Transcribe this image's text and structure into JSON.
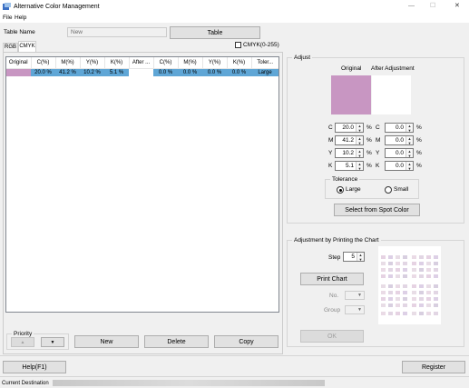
{
  "window": {
    "title": "Alternative Color Management",
    "min": "—",
    "max": "☐",
    "close": "✕"
  },
  "menu": {
    "file": "File",
    "help": "Help"
  },
  "top": {
    "table_name_label": "Table Name",
    "table_name_value": "New",
    "table_button": "Table"
  },
  "tabs": [
    {
      "label": "RGB"
    },
    {
      "label": "CMYK"
    }
  ],
  "cmyk_range_label": "CMYK(0-255)",
  "table": {
    "headers": [
      "Original",
      "C(%)",
      "M(%)",
      "Y(%)",
      "K(%)",
      "After ...",
      "C(%)",
      "M(%)",
      "Y(%)",
      "K(%)",
      "Toler..."
    ],
    "rows": [
      {
        "original_color": "#c896c2",
        "c": "20.0 %",
        "m": "41.2 %",
        "y": "10.2 %",
        "k": "5.1 %",
        "after_color": "#ffffff",
        "c2": "0.0 %",
        "m2": "0.0 %",
        "y2": "0.0 %",
        "k2": "0.0 %",
        "tolerance": "Large"
      }
    ]
  },
  "priority": {
    "label": "Priority",
    "up": "▲",
    "down": "▼"
  },
  "actions": {
    "new": "New",
    "delete": "Delete",
    "copy": "Copy"
  },
  "adjust": {
    "label": "Adjust",
    "original_label": "Original",
    "after_label": "After Adjustment",
    "original_color": "#c896c2",
    "after_color": "#ffffff",
    "left": [
      {
        "ch": "C",
        "value": "20.0",
        "unit": "%"
      },
      {
        "ch": "M",
        "value": "41.2",
        "unit": "%"
      },
      {
        "ch": "Y",
        "value": "10.2",
        "unit": "%"
      },
      {
        "ch": "K",
        "value": "5.1",
        "unit": "%"
      }
    ],
    "right": [
      {
        "ch": "C",
        "value": "0.0",
        "unit": "%"
      },
      {
        "ch": "M",
        "value": "0.0",
        "unit": "%"
      },
      {
        "ch": "Y",
        "value": "0.0",
        "unit": "%"
      },
      {
        "ch": "K",
        "value": "0.0",
        "unit": "%"
      }
    ],
    "tolerance": {
      "label": "Tolerance",
      "large": "Large",
      "small": "Small",
      "selected": "large"
    },
    "spot_button": "Select from Spot Color"
  },
  "printing": {
    "label": "Adjustment by Printing the Chart",
    "step_label": "Step",
    "step_value": "5",
    "print_button": "Print Chart",
    "no_label": "No.",
    "group_label": "Group",
    "ok_button": "OK"
  },
  "bottom": {
    "help": "Help(F1)",
    "register": "Register"
  },
  "status": {
    "label": "Current Destination"
  }
}
